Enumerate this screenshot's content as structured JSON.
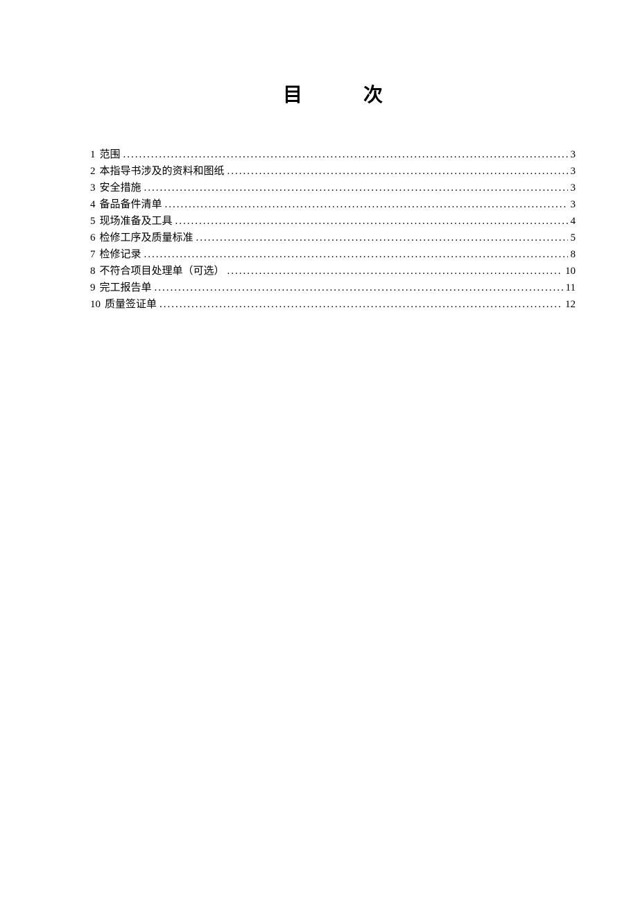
{
  "title": "目　次",
  "toc": {
    "entries": [
      {
        "num": "1",
        "label": "范围",
        "page": "3"
      },
      {
        "num": "2",
        "label": "本指导书涉及的资料和图纸",
        "page": "3"
      },
      {
        "num": "3",
        "label": "安全措施",
        "page": "3"
      },
      {
        "num": "4",
        "label": "备品备件清单",
        "page": "3"
      },
      {
        "num": "5",
        "label": "现场准备及工具",
        "page": "4"
      },
      {
        "num": "6",
        "label": "检修工序及质量标准",
        "page": "5"
      },
      {
        "num": "7",
        "label": "检修记录",
        "page": "8"
      },
      {
        "num": "8",
        "label": "不符合项目处理单（可选）",
        "page": "10"
      },
      {
        "num": "9",
        "label": "完工报告单",
        "page": "11"
      },
      {
        "num": "10",
        "label": "质量签证单",
        "page": "12"
      }
    ]
  }
}
